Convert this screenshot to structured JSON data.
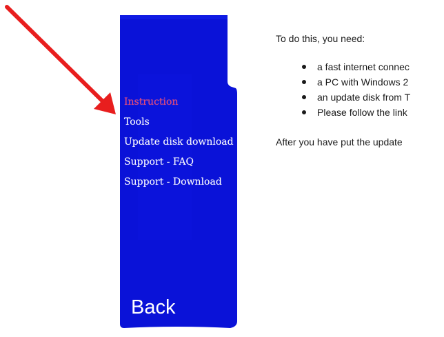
{
  "colors": {
    "sidebar_bg": "#0a12d8",
    "active_item": "#f0466e",
    "arrow": "#e81e1e",
    "text": "#1a1a1a"
  },
  "sidebar": {
    "items": [
      {
        "label": "Instruction",
        "active": true
      },
      {
        "label": "Tools",
        "active": false
      },
      {
        "label": "Update disk download",
        "active": false
      },
      {
        "label": "Support - FAQ",
        "active": false
      },
      {
        "label": "Support - Download",
        "active": false
      }
    ],
    "back_label": "Back"
  },
  "annotation": {
    "icon": "red-arrow-icon"
  },
  "content": {
    "intro": "To do this, you need:",
    "requirements": [
      "a fast internet connec",
      "a PC with Windows 2",
      "an update disk from T",
      "Please follow the link"
    ],
    "outro": "After you have put the update"
  }
}
